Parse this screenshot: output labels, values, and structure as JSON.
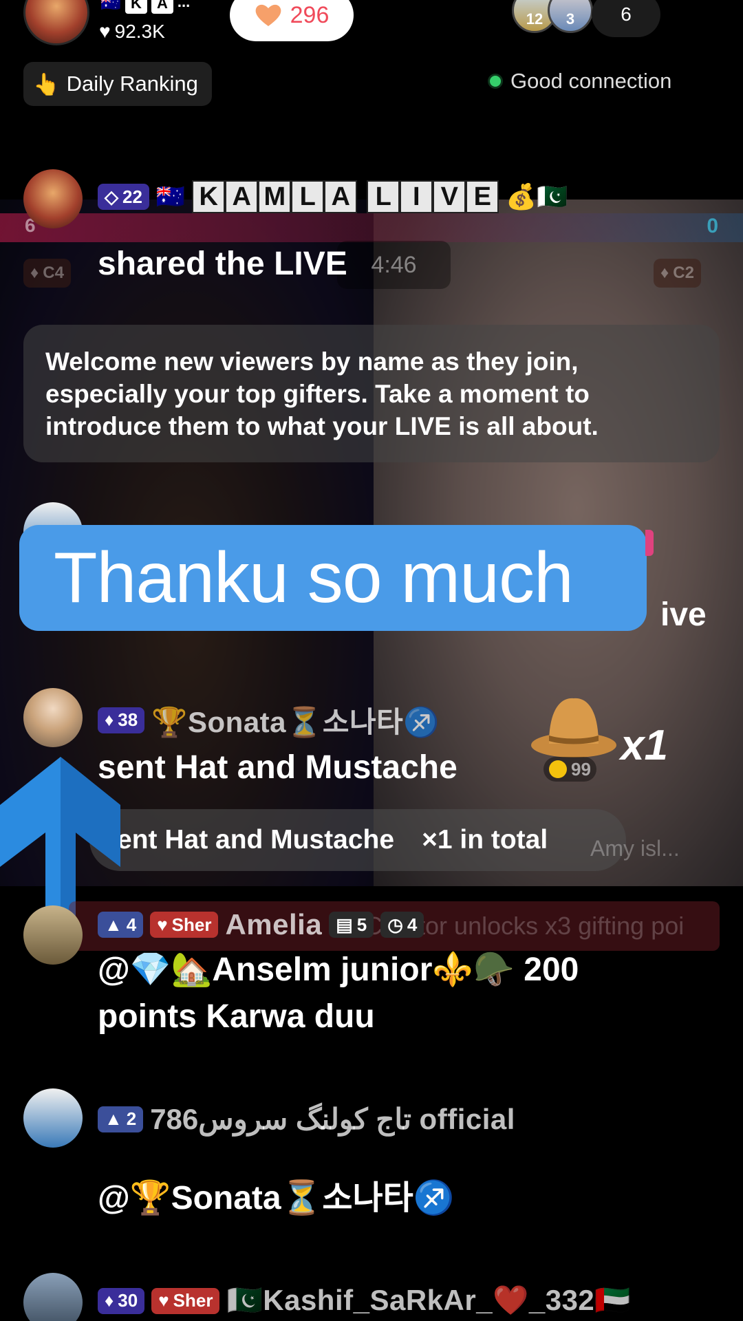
{
  "header": {
    "host_flags": [
      "K",
      "A",
      "..."
    ],
    "host_likes": "92.3K",
    "likes_count": "296",
    "viewer_badges": [
      "12",
      "3"
    ],
    "viewer_count": "6"
  },
  "daily_ranking": {
    "emoji": "👆",
    "label": "Daily Ranking"
  },
  "connection": {
    "status": "Good connection"
  },
  "pk": {
    "left_score": "6",
    "right_score": "0",
    "timer": "4:46",
    "left_tag": "C4",
    "right_tag": "C2"
  },
  "share_event": {
    "badge": "22",
    "flag": "🇦🇺",
    "letters": [
      "K",
      "A",
      "M",
      "L",
      "A",
      "L",
      "I",
      "V",
      "E"
    ],
    "suffix": "💰🇵🇰",
    "message": "shared the LIVE"
  },
  "tip": {
    "text": "Welcome new viewers by name as they join, especially your top gifters. Take a moment to introduce them to what your LIVE is all about."
  },
  "caption": {
    "text": "Thanku so much",
    "behind_text": "ive"
  },
  "gift_event": {
    "badge": "38",
    "name": "🏆Sonata⏳소나타♐",
    "message": "sent Hat and Mustache",
    "multiplier": "x1",
    "coins": "99",
    "total_text": "ent Hat and Mustache",
    "total_count": "×1 in total",
    "ghost": "Amy isl..."
  },
  "promo": {
    "text": "Creator unlocks x3 gifting poi"
  },
  "comments": [
    {
      "level": "4",
      "team": "Sher",
      "name": "Amelia",
      "stat1": "5",
      "stat2": "4",
      "message_line1": "@💎🏡Anselm junior⚜️🪖 200",
      "message_line2": "points Karwa duu"
    },
    {
      "level": "2",
      "name": "786تاج کولنگ سروس official",
      "message_line1": "@🏆Sonata⏳소나타♐"
    },
    {
      "badge": "30",
      "team": "Sher",
      "name": "🇵🇰Kashif_SaRkAr_❤️_332🇦🇪"
    }
  ],
  "colors": {
    "caption_bg": "#4a9be8",
    "connection_dot": "#35d06b",
    "likes_text": "#f04a5a",
    "badge_diamond": "#3a2e9a",
    "badge_sher": "#b8322e"
  }
}
